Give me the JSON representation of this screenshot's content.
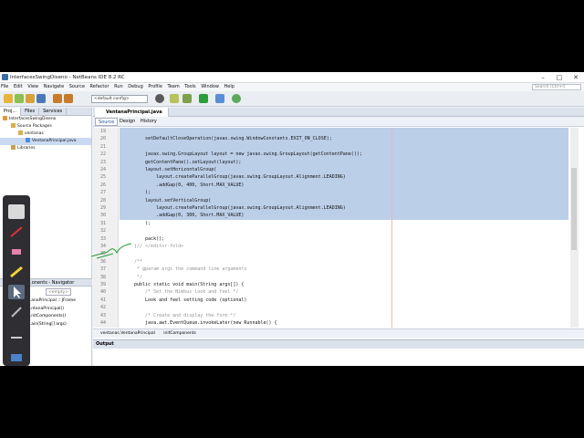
{
  "window": {
    "title": "InterfacesSwingDiseno - NetBeans IDE 8.2 RC"
  },
  "menu": [
    "File",
    "Edit",
    "View",
    "Navigate",
    "Source",
    "Refactor",
    "Run",
    "Debug",
    "Profile",
    "Team",
    "Tools",
    "Window",
    "Help"
  ],
  "toolbar": {
    "config": "<default config>"
  },
  "search": {
    "placeholder": "Search (Ctrl+I)"
  },
  "projects": {
    "tabs": [
      "Proj...",
      "Files",
      "Services"
    ],
    "tree": [
      "InterfacesSwingDiseno",
      "Source Packages",
      "ventanas",
      "VentanaPrincipal.java",
      "Libraries"
    ]
  },
  "navigator": {
    "title": "...onents - Navigator",
    "combo": "<empty>",
    "items": [
      "...anaPrincipal :: JFrame",
      "...ntanaPrincipal()",
      "...nitComponents()",
      "...ain(String[] args)"
    ]
  },
  "editor": {
    "tab": "VentanaPrincipal.java",
    "views": [
      "Source",
      "Design",
      "History"
    ]
  },
  "code": [
    {
      "n": "19",
      "t": ""
    },
    {
      "n": "20",
      "t": "    setDefaultCloseOperation(javax.swing.WindowConstants.EXIT_ON_CLOSE);"
    },
    {
      "n": "21",
      "t": ""
    },
    {
      "n": "22",
      "t": "    javax.swing.GroupLayout layout = new javax.swing.GroupLayout(getContentPane());"
    },
    {
      "n": "23",
      "t": "    getContentPane().setLayout(layout);"
    },
    {
      "n": "24",
      "t": "    layout.setHorizontalGroup("
    },
    {
      "n": "25",
      "t": "        layout.createParallelGroup(javax.swing.GroupLayout.Alignment.LEADING)"
    },
    {
      "n": "26",
      "t": "        .addGap(0, 400, Short.MAX_VALUE)"
    },
    {
      "n": "27",
      "t": "    );"
    },
    {
      "n": "28",
      "t": "    layout.setVerticalGroup("
    },
    {
      "n": "29",
      "t": "        layout.createParallelGroup(javax.swing.GroupLayout.Alignment.LEADING)"
    },
    {
      "n": "30",
      "t": "        .addGap(0, 300, Short.MAX_VALUE)"
    },
    {
      "n": "31",
      "t": "    );"
    },
    {
      "n": "32",
      "t": ""
    },
    {
      "n": "33",
      "t": "    pack();"
    },
    {
      "n": "34",
      "t": "}// </editor-fold>"
    },
    {
      "n": "35",
      "t": ""
    },
    {
      "n": "36",
      "t": "/**"
    },
    {
      "n": "37",
      "t": " * @param args the command line arguments"
    },
    {
      "n": "38",
      "t": " */"
    },
    {
      "n": "39",
      "t": "public static void main(String args[]) {"
    },
    {
      "n": "40",
      "t": "    /* Set the Nimbus look and feel */"
    },
    {
      "n": "41",
      "t": "    Look and feel setting code (optional)"
    },
    {
      "n": "42",
      "t": ""
    },
    {
      "n": "43",
      "t": "    /* Create and display the form */"
    },
    {
      "n": "44",
      "t": "    java.awt.EventQueue.invokeLater(new Runnable() {"
    }
  ],
  "breadcrumb": [
    "ventanas.VentanaPrincipal",
    "initComponents"
  ],
  "output": {
    "title": "Output"
  }
}
